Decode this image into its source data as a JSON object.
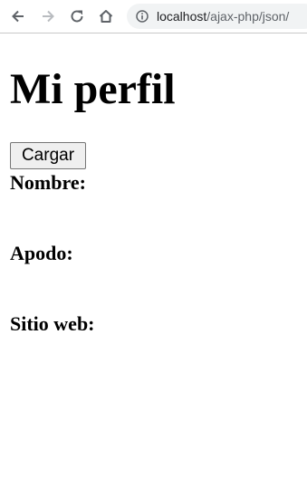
{
  "browser": {
    "url_host": "localhost",
    "url_path": "/ajax-php/json/"
  },
  "page": {
    "title": "Mi perfil",
    "load_button": "Cargar",
    "fields": {
      "name_label": "Nombre:",
      "nickname_label": "Apodo:",
      "website_label": "Sitio web:"
    }
  }
}
